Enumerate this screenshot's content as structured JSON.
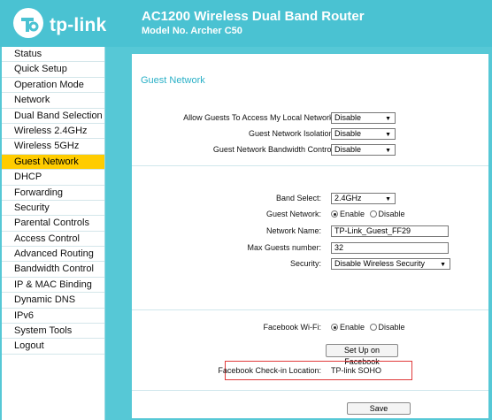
{
  "header": {
    "logo_text": "tp-link",
    "product_title": "AC1200 Wireless Dual Band Router",
    "product_model": "Model No. Archer C50"
  },
  "sidebar": {
    "items": [
      {
        "label": "Status"
      },
      {
        "label": "Quick Setup"
      },
      {
        "label": "Operation Mode"
      },
      {
        "label": "Network"
      },
      {
        "label": "Dual Band Selection"
      },
      {
        "label": "Wireless 2.4GHz"
      },
      {
        "label": "Wireless 5GHz"
      },
      {
        "label": "Guest Network",
        "active": true
      },
      {
        "label": "DHCP"
      },
      {
        "label": "Forwarding"
      },
      {
        "label": "Security"
      },
      {
        "label": "Parental Controls"
      },
      {
        "label": "Access Control"
      },
      {
        "label": "Advanced Routing"
      },
      {
        "label": "Bandwidth Control"
      },
      {
        "label": "IP & MAC Binding"
      },
      {
        "label": "Dynamic DNS"
      },
      {
        "label": "IPv6"
      },
      {
        "label": "System Tools"
      },
      {
        "label": "Logout"
      }
    ]
  },
  "main": {
    "title": "Guest Network",
    "general": {
      "allow_local_label": "Allow Guests To Access My Local Network:",
      "allow_local_value": "Disable",
      "isolation_label": "Guest Network Isolation:",
      "isolation_value": "Disable",
      "bandwidth_label": "Guest Network Bandwidth Control:",
      "bandwidth_value": "Disable"
    },
    "wireless": {
      "band_label": "Band Select:",
      "band_value": "2.4GHz",
      "guest_network_label": "Guest Network:",
      "enable_label": "Enable",
      "disable_label": "Disable",
      "network_name_label": "Network Name:",
      "network_name_value": "TP-Link_Guest_FF29",
      "max_guests_label": "Max Guests number:",
      "max_guests_value": "32",
      "security_label": "Security:",
      "security_value": "Disable Wireless Security"
    },
    "facebook": {
      "wifi_label": "Facebook Wi-Fi:",
      "enable_label": "Enable",
      "disable_label": "Disable",
      "setup_button": "Set Up on Facebook",
      "checkin_label": "Facebook Check-in Location:",
      "checkin_value": "TP-link SOHO"
    },
    "save_button": "Save"
  },
  "colors": {
    "brand": "#4ac2d2",
    "active_nav": "#ffcc00",
    "title_text": "#2ab0c7",
    "highlight": "#e03a3a"
  }
}
